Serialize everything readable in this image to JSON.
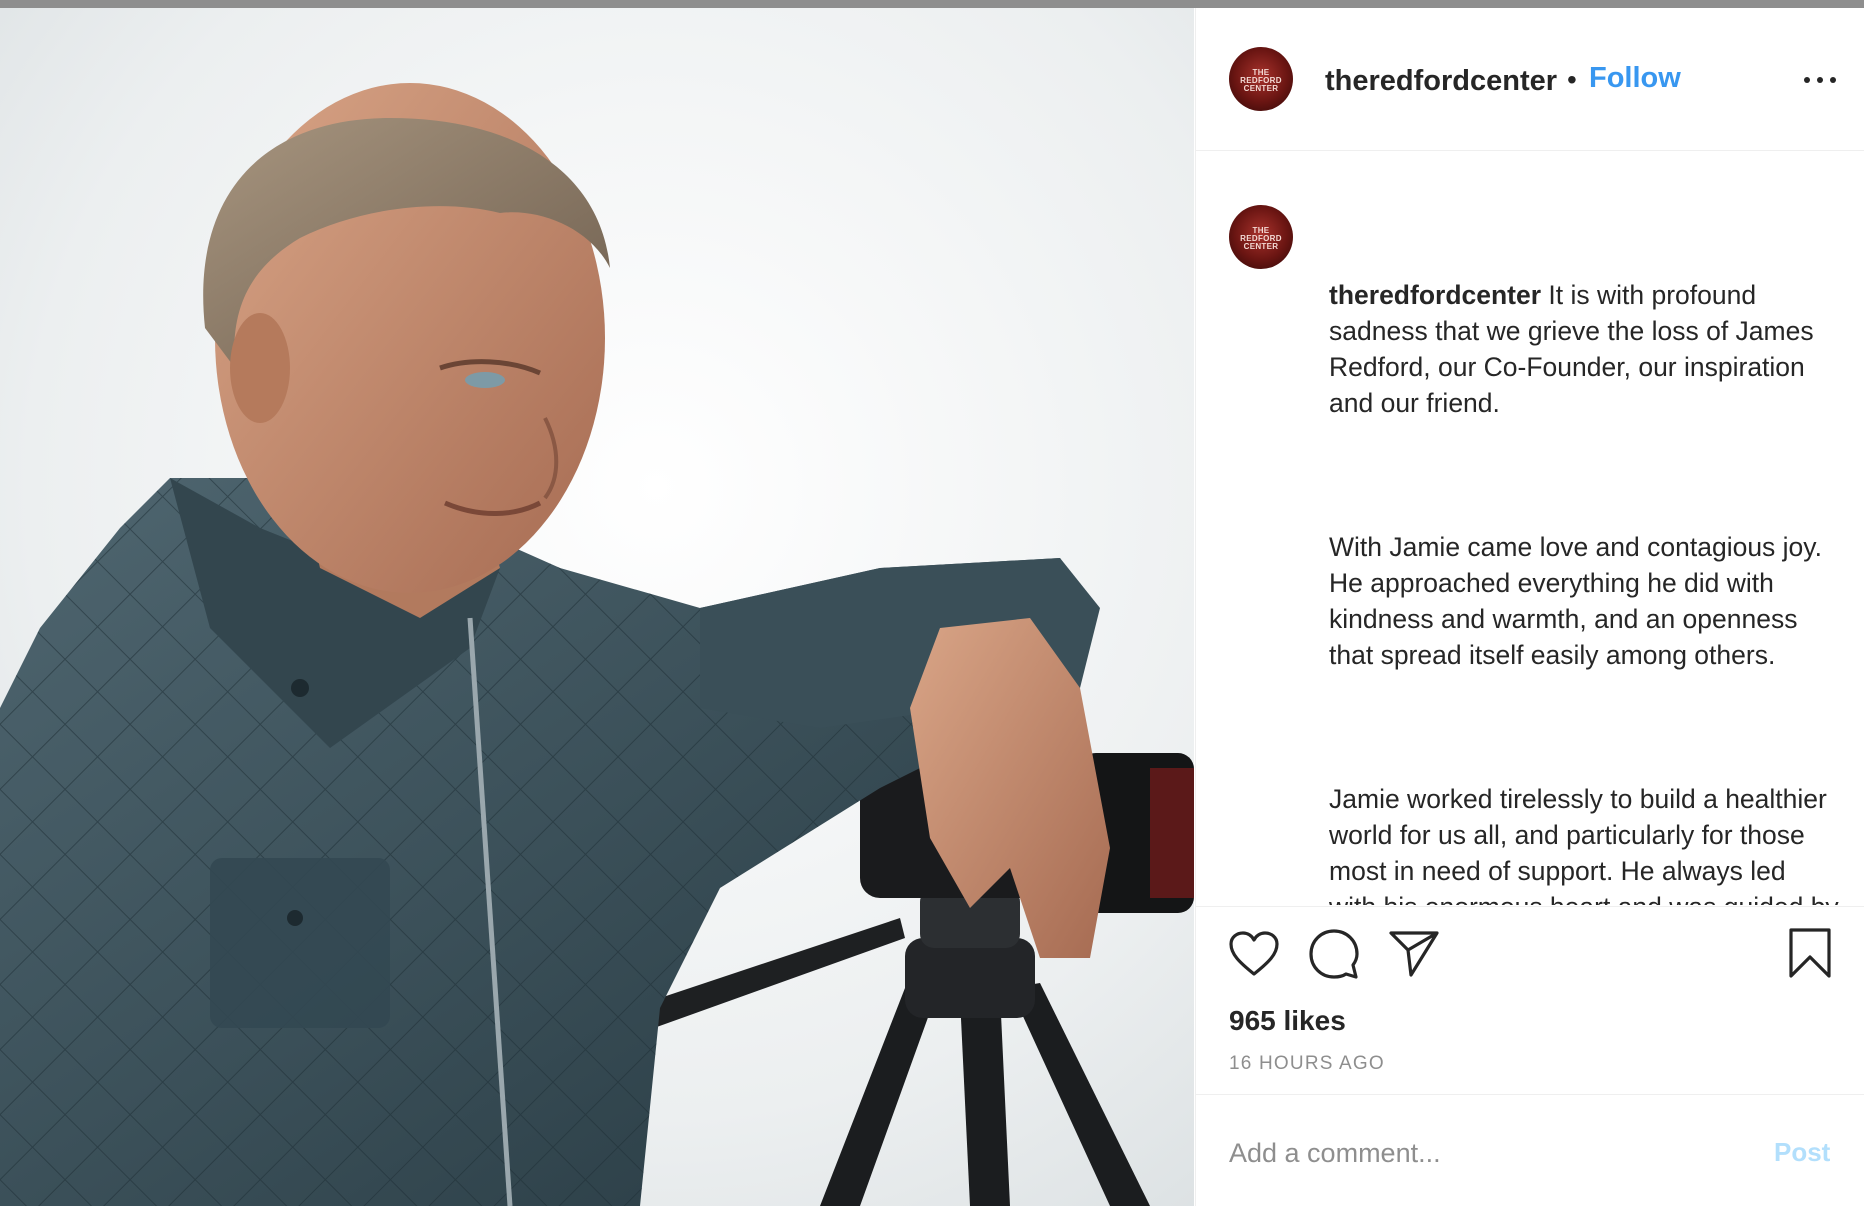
{
  "post": {
    "username": "theredfordcenter",
    "avatar_logo_lines": [
      "THE",
      "REDFORD",
      "CENTER"
    ],
    "follow_label": "Follow",
    "separator": "•",
    "caption_paragraph_1": "It is with profound sadness that we grieve the loss of James Redford, our Co-Founder, our inspiration and our friend.",
    "caption_paragraph_2": "With Jamie came love and contagious joy. He approached everything he did with kindness and warmth, and an openness that spread itself easily among others.",
    "caption_paragraph_3": "Jamie worked tirelessly to build a healthier world for us all, and particularly for those most in need of support. He always led with his enormous heart and was guided by his curiosity and creative spirit. He was a fierce protector of the natural world and believed that everyone deserved a healthy environment in which they",
    "likes": "965 likes",
    "timestamp": "16 HOURS AGO",
    "comment_placeholder": "Add a comment...",
    "post_label": "Post"
  },
  "icons": {
    "more": "more-options-icon",
    "like": "heart-icon",
    "comment": "comment-icon",
    "share": "share-icon",
    "save": "bookmark-icon"
  },
  "colors": {
    "accent": "#3897f0",
    "post_disabled": "#b2dffc",
    "text": "#262626",
    "muted": "#8e8e8e",
    "avatar": "#8b1f1a"
  }
}
